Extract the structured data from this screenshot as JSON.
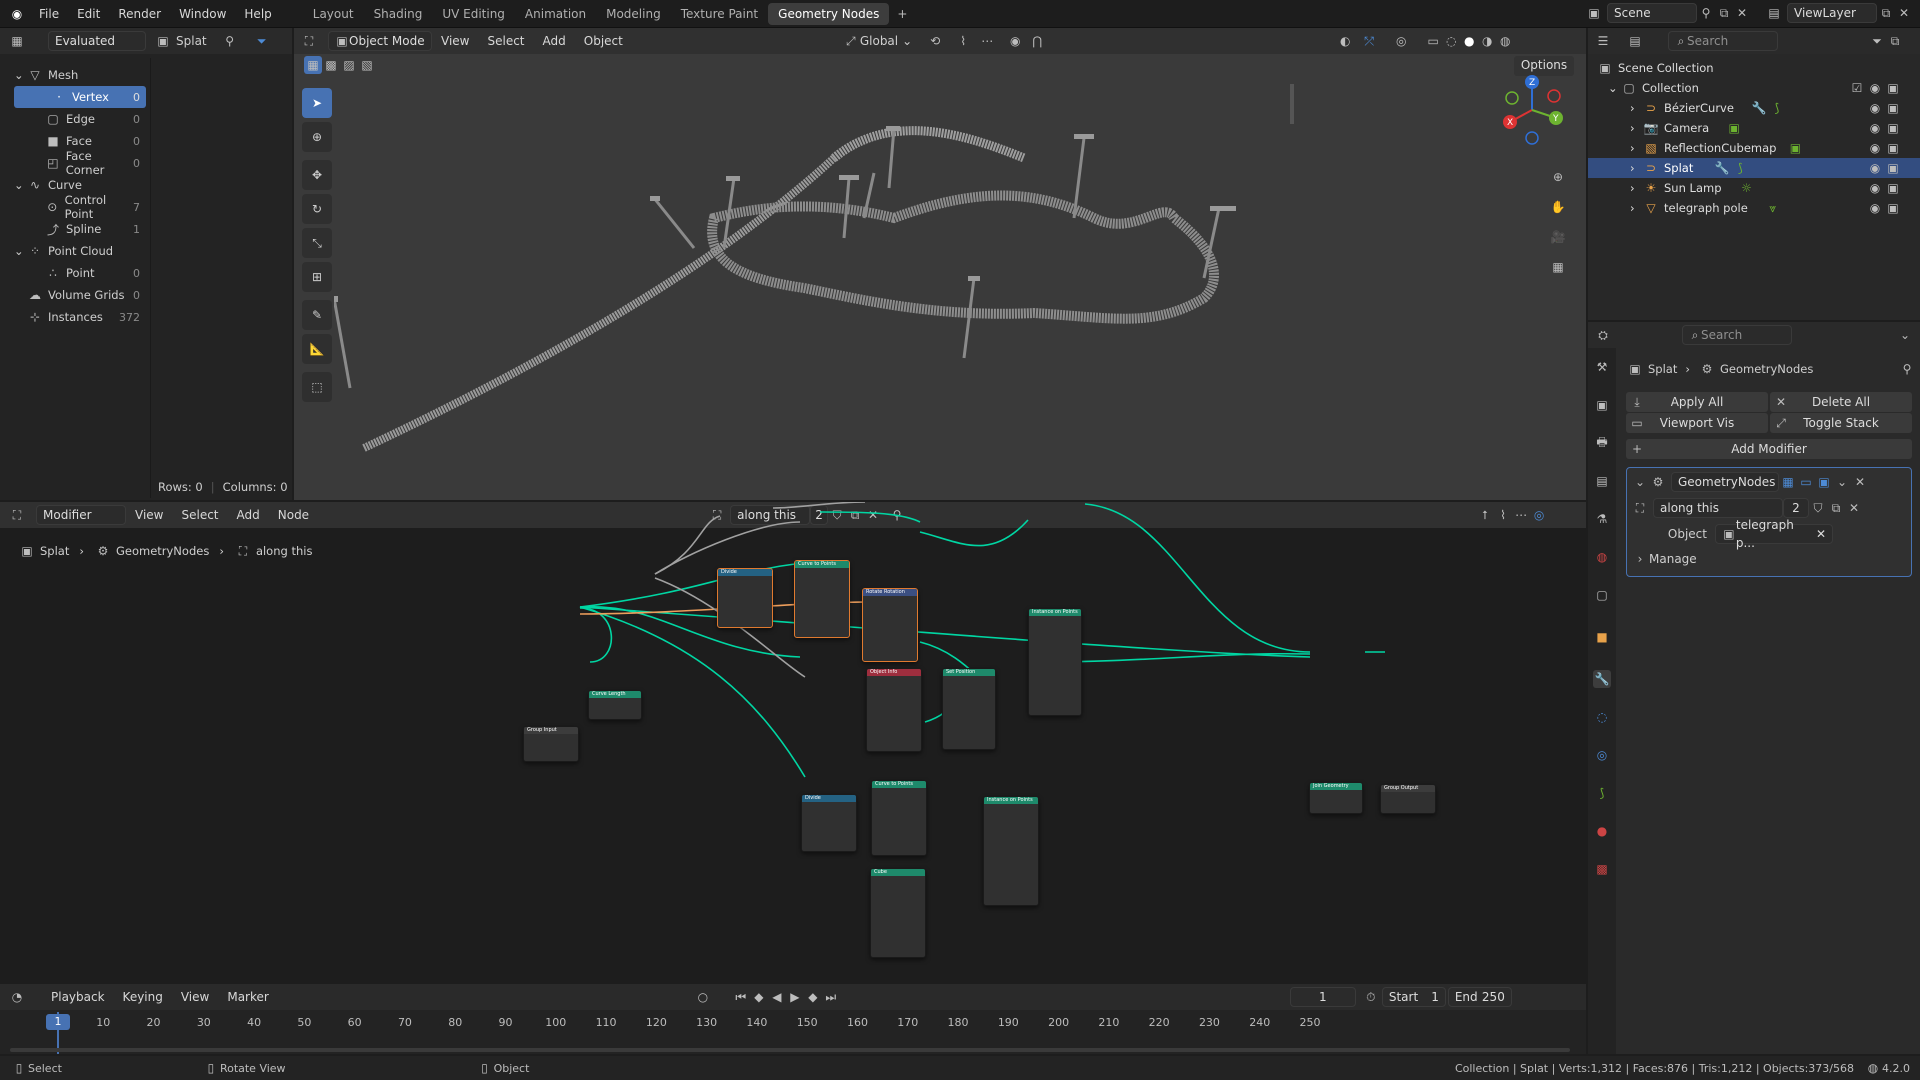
{
  "topbar": {
    "menus": [
      "File",
      "Edit",
      "Render",
      "Window",
      "Help"
    ],
    "workspaces": [
      "Layout",
      "Shading",
      "UV Editing",
      "Animation",
      "Modeling",
      "Texture Paint",
      "Geometry Nodes"
    ],
    "active_workspace": "Geometry Nodes",
    "scene": "Scene",
    "view_layer": "ViewLayer"
  },
  "spreadsheet": {
    "mode": "Evaluated",
    "object": "Splat",
    "tree": [
      {
        "label": "Mesh",
        "count": "",
        "level": 0,
        "icon": "mesh-icon"
      },
      {
        "label": "Vertex",
        "count": "0",
        "level": 1,
        "icon": "vertex-icon",
        "selected": true
      },
      {
        "label": "Edge",
        "count": "0",
        "level": 1,
        "icon": "edge-icon"
      },
      {
        "label": "Face",
        "count": "0",
        "level": 1,
        "icon": "face-icon"
      },
      {
        "label": "Face Corner",
        "count": "0",
        "level": 1,
        "icon": "face-corner-icon"
      },
      {
        "label": "Curve",
        "count": "",
        "level": 0,
        "icon": "curve-icon"
      },
      {
        "label": "Control Point",
        "count": "7",
        "level": 1,
        "icon": "control-point-icon"
      },
      {
        "label": "Spline",
        "count": "1",
        "level": 1,
        "icon": "spline-icon"
      },
      {
        "label": "Point Cloud",
        "count": "",
        "level": 0,
        "icon": "point-cloud-icon"
      },
      {
        "label": "Point",
        "count": "0",
        "level": 1,
        "icon": "point-icon"
      },
      {
        "label": "Volume Grids",
        "count": "0",
        "level": 0,
        "icon": "volume-icon"
      },
      {
        "label": "Instances",
        "count": "372",
        "level": 0,
        "icon": "instances-icon"
      }
    ],
    "rows": "Rows: 0",
    "columns": "Columns: 0"
  },
  "viewport": {
    "mode": "Object Mode",
    "menus": [
      "View",
      "Select",
      "Add",
      "Object"
    ],
    "orientation": "Global",
    "options": "Options"
  },
  "outliner": {
    "search_placeholder": "Search",
    "root": "Scene Collection",
    "collection": "Collection",
    "items": [
      {
        "label": "BézierCurve",
        "color": "#e8a24a"
      },
      {
        "label": "Camera",
        "color": "#e8a24a"
      },
      {
        "label": "ReflectionCubemap",
        "color": "#e8a24a"
      },
      {
        "label": "Splat",
        "color": "#e8a24a",
        "selected": true
      },
      {
        "label": "Sun Lamp",
        "color": "#e8a24a"
      },
      {
        "label": "telegraph pole",
        "color": "#e8a24a"
      }
    ]
  },
  "properties": {
    "search_placeholder": "Search",
    "breadcrumb": [
      "Splat",
      "GeometryNodes"
    ],
    "apply_all": "Apply All",
    "delete_all": "Delete All",
    "viewport_vis": "Viewport Vis",
    "toggle_stack": "Toggle Stack",
    "add_modifier": "Add Modifier",
    "modifier_name": "GeometryNodes",
    "node_group": "along this",
    "users": "2",
    "object_label": "Object",
    "object_value": "telegraph p...",
    "manage": "Manage"
  },
  "node_editor": {
    "type": "Modifier",
    "menus": [
      "View",
      "Select",
      "Add",
      "Node"
    ],
    "node_group": "along this",
    "users": "2",
    "breadcrumb": [
      "Splat",
      "GeometryNodes",
      "along this"
    ],
    "nodes": {
      "group_input": "Group Input",
      "curve_length": "Curve Length",
      "divide1": "Divide",
      "curve_to_points1": "Curve to Points",
      "rotate_rotation": "Rotate Rotation",
      "object_info": "Object Info",
      "set_position": "Set Position",
      "instance_on_points1": "Instance on Points",
      "divide2": "Divide",
      "curve_to_points2": "Curve to Points",
      "instance_on_points2": "Instance on Points",
      "cube": "Cube",
      "join_geometry": "Join Geometry",
      "group_output": "Group Output"
    }
  },
  "timeline": {
    "menus": [
      "Playback",
      "Keying",
      "View",
      "Marker"
    ],
    "current_frame": "1",
    "start_label": "Start",
    "start": "1",
    "end_label": "End",
    "end": "250",
    "ticks": [
      "1",
      "10",
      "20",
      "30",
      "40",
      "50",
      "60",
      "70",
      "80",
      "90",
      "100",
      "110",
      "120",
      "130",
      "140",
      "150",
      "160",
      "170",
      "180",
      "190",
      "200",
      "210",
      "220",
      "230",
      "240",
      "250"
    ]
  },
  "statusbar": {
    "select": "Select",
    "rotate": "Rotate View",
    "object": "Object",
    "stats": "Collection | Splat | Verts:1,312 | Faces:876 | Tris:1,212 | Objects:373/568",
    "version": "4.2.0"
  },
  "colors": {
    "accent": "#4772b3",
    "geometry_link": "#00d6a3",
    "float_link": "#a1a1a1",
    "object_link": "#ed9e5c",
    "selected_node": "#e07a2f"
  }
}
